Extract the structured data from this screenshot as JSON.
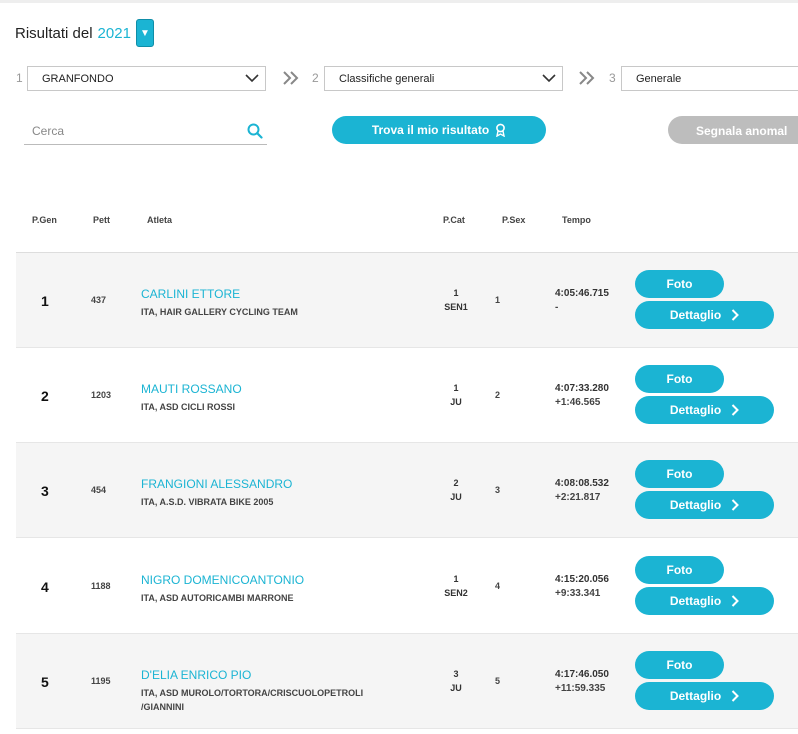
{
  "header": {
    "title": "Risultati del",
    "year": "2021",
    "year_toggle_glyph": "▼"
  },
  "filters": [
    {
      "step": "1",
      "selected": "GRANFONDO"
    },
    {
      "step": "2",
      "selected": "Classifiche generali"
    },
    {
      "step": "3",
      "selected": "Generale"
    }
  ],
  "search": {
    "placeholder": "Cerca",
    "value": ""
  },
  "actions": {
    "find_label": "Trova il mio risultato",
    "report_label": "Segnala anomal"
  },
  "table": {
    "headers": {
      "pgen": "P.Gen",
      "pett": "Pett",
      "atleta": "Atleta",
      "pcat": "P.Cat",
      "psex": "P.Sex",
      "tempo": "Tempo"
    },
    "rows": [
      {
        "pos": "1",
        "bib": "437",
        "name": "CARLINI ETTORE",
        "team": "ITA, HAIR GALLERY CYCLING TEAM",
        "pcat": "1",
        "cat": "SEN1",
        "psex": "1",
        "time": "4:05:46.715",
        "gap": "-",
        "foto": "Foto",
        "detail": "Dettaglio"
      },
      {
        "pos": "2",
        "bib": "1203",
        "name": "MAUTI ROSSANO",
        "team": "ITA, ASD CICLI ROSSI",
        "pcat": "1",
        "cat": "JU",
        "psex": "2",
        "time": "4:07:33.280",
        "gap": "+1:46.565",
        "foto": "Foto",
        "detail": "Dettaglio"
      },
      {
        "pos": "3",
        "bib": "454",
        "name": "FRANGIONI ALESSANDRO",
        "team": "ITA, A.S.D. VIBRATA BIKE 2005",
        "pcat": "2",
        "cat": "JU",
        "psex": "3",
        "time": "4:08:08.532",
        "gap": "+2:21.817",
        "foto": "Foto",
        "detail": "Dettaglio"
      },
      {
        "pos": "4",
        "bib": "1188",
        "name": "NIGRO DOMENICOANTONIO",
        "team": "ITA, ASD AUTORICAMBI MARRONE",
        "pcat": "1",
        "cat": "SEN2",
        "psex": "4",
        "time": "4:15:20.056",
        "gap": "+9:33.341",
        "foto": "Foto",
        "detail": "Dettaglio"
      },
      {
        "pos": "5",
        "bib": "1195",
        "name": "D'ELIA ENRICO PIO",
        "team": "ITA, ASD MUROLO/TORTORA/CRISCUOLOPETROLI\n/GIANNINI",
        "pcat": "3",
        "cat": "JU",
        "psex": "5",
        "time": "4:17:46.050",
        "gap": "+11:59.335",
        "foto": "Foto",
        "detail": "Dettaglio"
      }
    ]
  },
  "colors": {
    "accent": "#1bb4d3",
    "disabled": "#bdbdbd",
    "row_alt": "#f5f5f5"
  },
  "icons": [
    "chevron-down-icon",
    "double-chevron-right-icon",
    "search-icon",
    "ribbon-icon",
    "chevron-right-icon"
  ]
}
